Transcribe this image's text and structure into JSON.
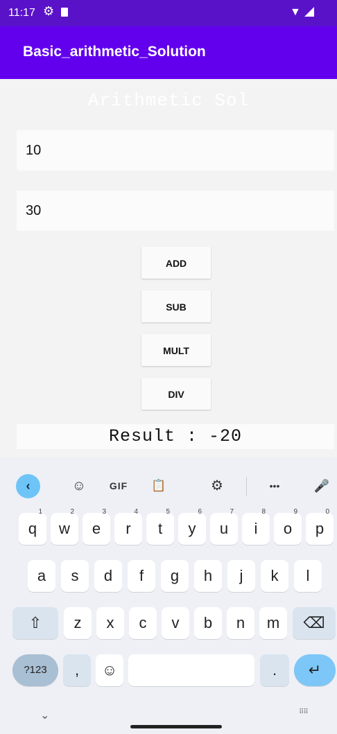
{
  "status_bar": {
    "time": "11:17",
    "gear_icon": "settings-gear-icon",
    "sd_icon": "sd-card-icon",
    "wifi_icon": "wifi-icon",
    "signal_icon": "cell-signal-icon"
  },
  "app_bar": {
    "title": "Basic_arithmetic_Solution"
  },
  "main": {
    "watermark": "Arithmetic Sol",
    "input1": "10",
    "input2": "30",
    "buttons": {
      "add": "ADD",
      "sub": "SUB",
      "mult": "MULT",
      "div": "DIV"
    },
    "result": "Result : -20"
  },
  "keyboard": {
    "toolbar": {
      "back": "‹",
      "sticker": "☺",
      "gif": "GIF",
      "clipboard": "📋",
      "settings": "⚙",
      "more": "•••",
      "mic": "🎤"
    },
    "row1": [
      {
        "key": "q",
        "hint": "1"
      },
      {
        "key": "w",
        "hint": "2"
      },
      {
        "key": "e",
        "hint": "3"
      },
      {
        "key": "r",
        "hint": "4"
      },
      {
        "key": "t",
        "hint": "5"
      },
      {
        "key": "y",
        "hint": "6"
      },
      {
        "key": "u",
        "hint": "7"
      },
      {
        "key": "i",
        "hint": "8"
      },
      {
        "key": "o",
        "hint": "9"
      },
      {
        "key": "p",
        "hint": "0"
      }
    ],
    "row2": [
      "a",
      "s",
      "d",
      "f",
      "g",
      "h",
      "j",
      "k",
      "l"
    ],
    "row3": [
      "z",
      "x",
      "c",
      "v",
      "b",
      "n",
      "m"
    ],
    "shift": "⇧",
    "backspace": "⌫",
    "symbols": "?123",
    "comma": ",",
    "emoji": "☺",
    "period": ".",
    "enter": "↵",
    "collapse": "⌄",
    "grid": "⠿⠿"
  },
  "colors": {
    "status_bar": "#5a12c8",
    "app_bar": "#6200ee",
    "keyboard_bg": "#eef0f6",
    "enter_key": "#7cc7f7",
    "symbols_key": "#a9bfd3"
  }
}
